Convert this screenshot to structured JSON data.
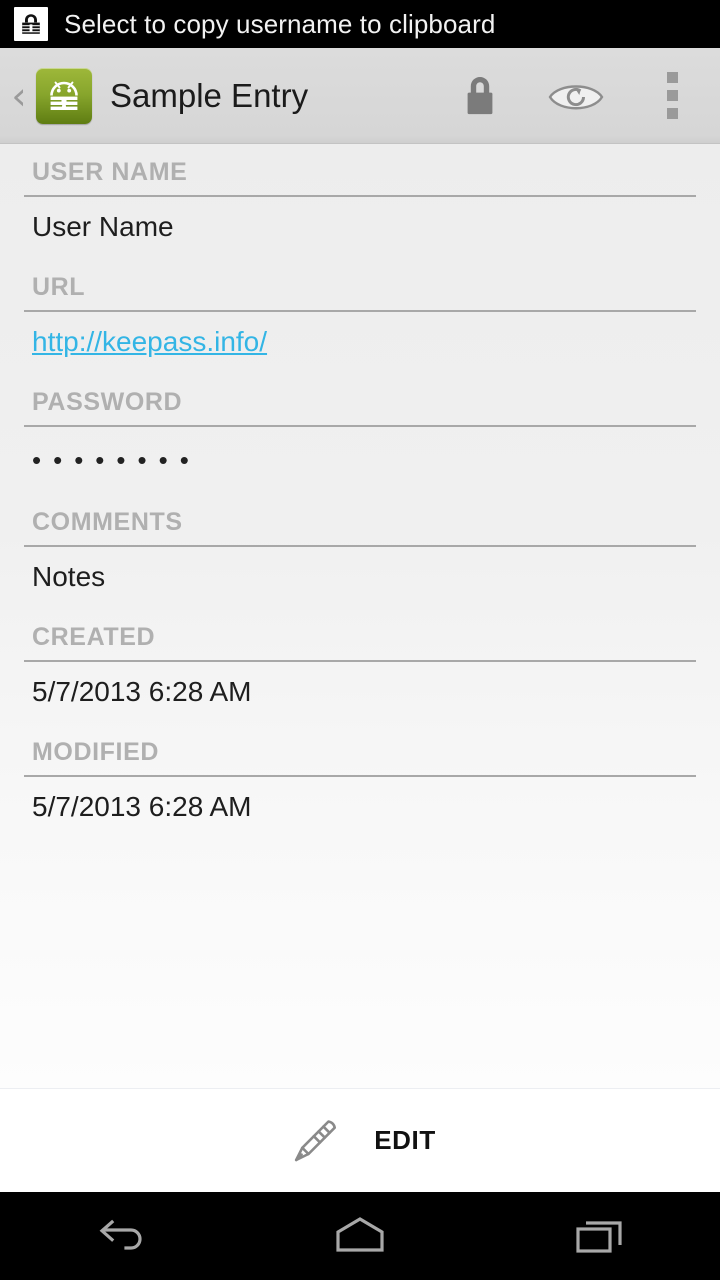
{
  "status_bar": {
    "icon": "keepass-lock-icon",
    "message": "Select to copy username to clipboard"
  },
  "action_bar": {
    "back_icon": "back-chevron-icon",
    "app_icon": "keepassdroid-app-icon",
    "title": "Sample Entry",
    "actions": [
      {
        "name": "lock-database-button",
        "icon": "lock-icon"
      },
      {
        "name": "toggle-password-button",
        "icon": "eye-reveal-icon"
      },
      {
        "name": "overflow-menu-button",
        "icon": "more-vertical-icon"
      }
    ]
  },
  "entry": {
    "fields": [
      {
        "label": "USER NAME",
        "value": "User Name",
        "type": "text"
      },
      {
        "label": "URL",
        "value": "http://keepass.info/",
        "type": "link"
      },
      {
        "label": "PASSWORD",
        "value": "••••••••",
        "type": "masked"
      },
      {
        "label": "COMMENTS",
        "value": "Notes",
        "type": "text"
      },
      {
        "label": "CREATED",
        "value": "5/7/2013 6:28 AM",
        "type": "text"
      },
      {
        "label": "MODIFIED",
        "value": "5/7/2013 6:28 AM",
        "type": "text"
      }
    ]
  },
  "bottom_bar": {
    "edit_label": "EDIT",
    "edit_icon": "pencil-icon"
  },
  "navigation_bar": {
    "buttons": [
      {
        "name": "nav-back-button",
        "icon": "back-arrow-icon"
      },
      {
        "name": "nav-home-button",
        "icon": "home-icon"
      },
      {
        "name": "nav-recents-button",
        "icon": "recents-icon"
      }
    ]
  },
  "colors": {
    "link": "#33b5e5",
    "app_icon_green": "#87a52c",
    "label_gray": "#b0b0b0",
    "action_bar": "#d6d6d6"
  }
}
